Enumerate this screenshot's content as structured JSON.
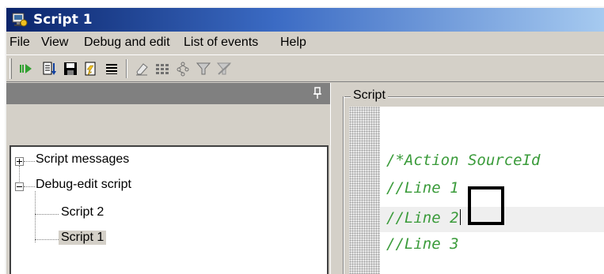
{
  "window": {
    "title": "Script 1"
  },
  "menu": {
    "items": [
      "File",
      "View",
      "Debug and edit",
      "List of events",
      "Help"
    ]
  },
  "toolbar": {
    "buttons": [
      "run-icon",
      "step-icon",
      "save-icon",
      "new-icon",
      "list-icon",
      "eraser-icon",
      "grid-icon",
      "tree-icon",
      "filter-icon",
      "filter-disabled-icon"
    ]
  },
  "tree": {
    "nodes": [
      {
        "label": "Script messages",
        "expander": "plus"
      },
      {
        "label": "Debug-edit script",
        "expander": "minus"
      },
      {
        "label": "Script 2"
      },
      {
        "label": "Script 1",
        "selected": true
      }
    ]
  },
  "script_panel": {
    "title": "Script",
    "lines": [
      "/*Action SourceId",
      "//Line 1",
      "//Line 2",
      "//Line 3"
    ],
    "code_color": "#3a9b3a"
  }
}
